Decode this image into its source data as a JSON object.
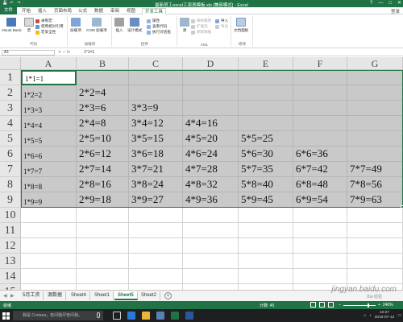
{
  "window": {
    "title": "最新员工excel工资表模板.xls [兼容模式] - Excel",
    "help": "?",
    "minimize": "—",
    "maximize": "□",
    "close": "✕",
    "qat": [
      "💾",
      "↶",
      "↷"
    ]
  },
  "ribbon_tabs": {
    "file": "文件",
    "tabs": [
      "开始",
      "插入",
      "页面布局",
      "公式",
      "数据",
      "审阅",
      "视图",
      "开发工具"
    ],
    "active": "开发工具",
    "login": "登录"
  },
  "ribbon": {
    "groups": [
      {
        "label": "代码",
        "big": [
          "Visual Basic",
          "宏"
        ],
        "small": [
          "录制宏",
          "使用相对引用",
          "宏安全性"
        ]
      },
      {
        "label": "加载项",
        "big": [
          "加载项",
          "COM 加载项"
        ]
      },
      {
        "label": "控件",
        "big": [
          "插入",
          "设计模式"
        ],
        "small": [
          "属性",
          "查看代码",
          "执行对话框"
        ]
      },
      {
        "label": "XML",
        "big": [
          "源"
        ],
        "small": [
          "映射属性",
          "扩展包",
          "刷新数据",
          "导入",
          "导出"
        ]
      },
      {
        "label": "修改",
        "big": [
          "文档面板"
        ]
      }
    ]
  },
  "formula_bar": {
    "name_box": "A1",
    "fx_controls": "✕ ✓ fx",
    "formula": "1*1=1"
  },
  "sheet": {
    "columns": [
      "A",
      "B",
      "C",
      "D",
      "E",
      "F",
      "G"
    ],
    "rows": [
      "1",
      "2",
      "3",
      "4",
      "5",
      "6",
      "7",
      "8",
      "9",
      "10",
      "11",
      "12",
      "13",
      "14",
      "15"
    ],
    "cells": [
      [
        "1*1=1",
        "",
        "",
        "",
        "",
        "",
        ""
      ],
      [
        "1*2=2",
        "2*2=4",
        "",
        "",
        "",
        "",
        ""
      ],
      [
        "1*3=3",
        "2*3=6",
        "3*3=9",
        "",
        "",
        "",
        ""
      ],
      [
        "1*4=4",
        "2*4=8",
        "3*4=12",
        "4*4=16",
        "",
        "",
        ""
      ],
      [
        "1*5=5",
        "2*5=10",
        "3*5=15",
        "4*5=20",
        "5*5=25",
        "",
        ""
      ],
      [
        "1*6=6",
        "2*6=12",
        "3*6=18",
        "4*6=24",
        "5*6=30",
        "6*6=36",
        ""
      ],
      [
        "1*7=7",
        "2*7=14",
        "3*7=21",
        "4*7=28",
        "5*7=35",
        "6*7=42",
        "7*7=49"
      ],
      [
        "1*8=8",
        "2*8=16",
        "3*8=24",
        "4*8=32",
        "5*8=40",
        "6*8=48",
        "7*8=56"
      ],
      [
        "1*9=9",
        "2*9=18",
        "3*9=27",
        "4*9=36",
        "5*9=45",
        "6*9=54",
        "7*9=63"
      ]
    ]
  },
  "sheet_tabs": {
    "prev": "◀",
    "next": "▶",
    "tabs": [
      "5月工资",
      "源数据",
      "Sheet4",
      "Sheet1",
      "Sheet5",
      "Sheet2"
    ],
    "active": "Sheet5",
    "add": "+"
  },
  "status_bar": {
    "ready": "就绪",
    "count": "计数: 45",
    "zoom": "246%"
  },
  "taskbar": {
    "search_placeholder": "我是 Cortana，有问题尽管问我。",
    "clock_time": "10:27",
    "clock_date": "2016-07-12"
  },
  "watermark": {
    "text": "jingyan.baidu.com",
    "sub": "Bai 经验"
  },
  "colors": {
    "excel_green": "#217346",
    "selection_gray": "#c9c9c9",
    "header_gray": "#e6e6e6"
  }
}
